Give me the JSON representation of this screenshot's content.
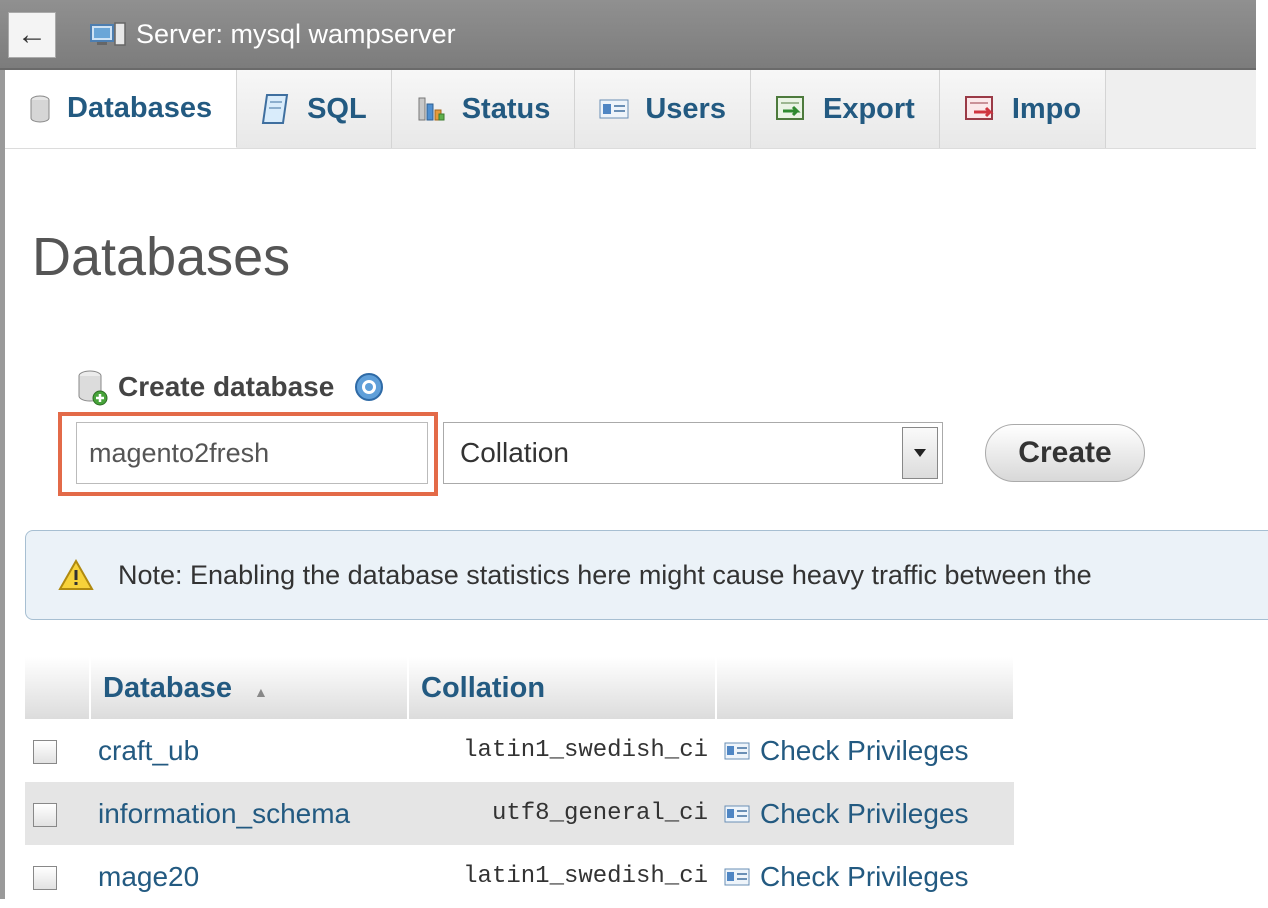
{
  "topbar": {
    "back_label": "←",
    "server_label": "Server: mysql wampserver"
  },
  "tabs": [
    {
      "label": "Databases",
      "icon": "database-icon",
      "active": true
    },
    {
      "label": "SQL",
      "icon": "sql-icon",
      "active": false
    },
    {
      "label": "Status",
      "icon": "status-chart-icon",
      "active": false
    },
    {
      "label": "Users",
      "icon": "users-icon",
      "active": false
    },
    {
      "label": "Export",
      "icon": "export-icon",
      "active": false
    },
    {
      "label": "Impo",
      "icon": "import-icon",
      "active": false
    }
  ],
  "page": {
    "title": "Databases"
  },
  "create_db": {
    "heading": "Create database",
    "name_value": "magento2fresh",
    "collation_selected": "Collation",
    "create_label": "Create",
    "highlight_color": "#e36a48"
  },
  "notice": {
    "text": "Note: Enabling the database statistics here might cause heavy traffic between the"
  },
  "table": {
    "headers": {
      "database": "Database",
      "collation": "Collation",
      "action": ""
    },
    "sort_indicator": "▲",
    "rows": [
      {
        "name": "craft_ub",
        "collation": "latin1_swedish_ci",
        "action": "Check Privileges"
      },
      {
        "name": "information_schema",
        "collation": "utf8_general_ci",
        "action": "Check Privileges"
      },
      {
        "name": "mage20",
        "collation": "latin1_swedish_ci",
        "action": "Check Privileges"
      }
    ]
  },
  "colors": {
    "link": "#235a81",
    "topbar": "#858585",
    "notice_bg": "#ebf2f8"
  }
}
